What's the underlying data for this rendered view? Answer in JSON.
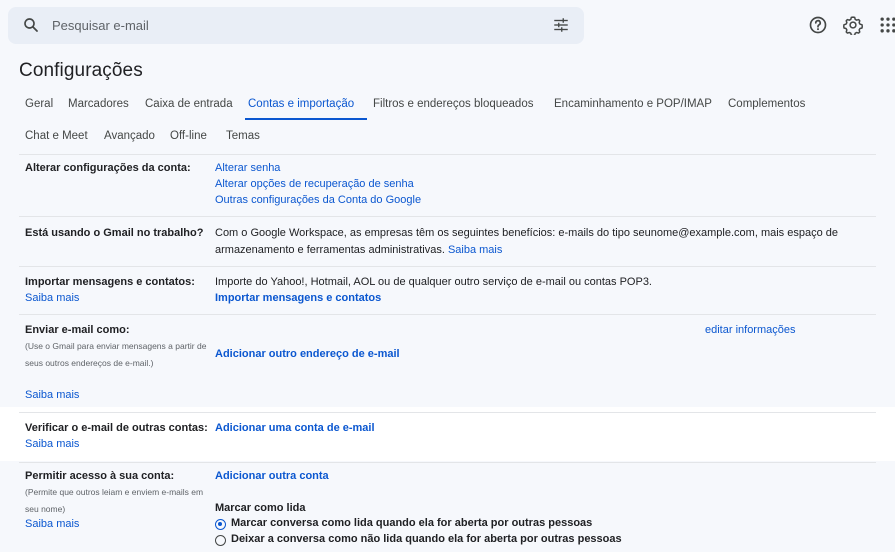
{
  "search": {
    "placeholder": "Pesquisar e-mail"
  },
  "header": {
    "title": "Configurações"
  },
  "tabs": [
    {
      "label": "Geral"
    },
    {
      "label": "Marcadores"
    },
    {
      "label": "Caixa de entrada"
    },
    {
      "label": "Contas e importação"
    },
    {
      "label": "Filtros e endereços bloqueados"
    },
    {
      "label": "Encaminhamento e POP/IMAP"
    },
    {
      "label": "Complementos"
    },
    {
      "label": "Chat e Meet"
    },
    {
      "label": "Avançado"
    },
    {
      "label": "Off-line"
    },
    {
      "label": "Temas"
    }
  ],
  "sections": {
    "change_account": {
      "label": "Alterar configurações da conta:",
      "links": [
        "Alterar senha",
        "Alterar opções de recuperação de senha",
        "Outras configurações da Conta do Google"
      ]
    },
    "workspace": {
      "label": "Está usando o Gmail no trabalho?",
      "text": "Com o Google Workspace, as empresas têm os seguintes benefícios: e-mails do tipo seunome@example.com, mais espaço de armazenamento e ferramentas administrativas.",
      "link": "Saiba mais"
    },
    "import": {
      "label": "Importar mensagens e contatos:",
      "learn": "Saiba mais",
      "text": "Importe do Yahoo!, Hotmail, AOL ou de qualquer outro serviço de e-mail ou contas POP3.",
      "action": "Importar mensagens e contatos"
    },
    "send_as": {
      "label": "Enviar e-mail como:",
      "sub": "(Use o Gmail para enviar mensagens a partir de seus outros endereços de e-mail.)",
      "learn": "Saiba mais",
      "edit": "editar informações",
      "action": "Adicionar outro endereço de e-mail"
    },
    "check_mail": {
      "label": "Verificar o e-mail de outras contas:",
      "learn": "Saiba mais",
      "action": "Adicionar uma conta de e-mail"
    },
    "grant": {
      "label": "Permitir acesso à sua conta:",
      "sub": "(Permite que outros leiam e enviem e-mails em seu nome)",
      "learn": "Saiba mais",
      "action": "Adicionar outra conta",
      "mark_title": "Marcar como lida",
      "opt1": "Marcar conversa como lida quando ela for aberta por outras pessoas",
      "opt2": "Deixar a conversa como não lida quando ela for aberta por outras pessoas"
    }
  }
}
